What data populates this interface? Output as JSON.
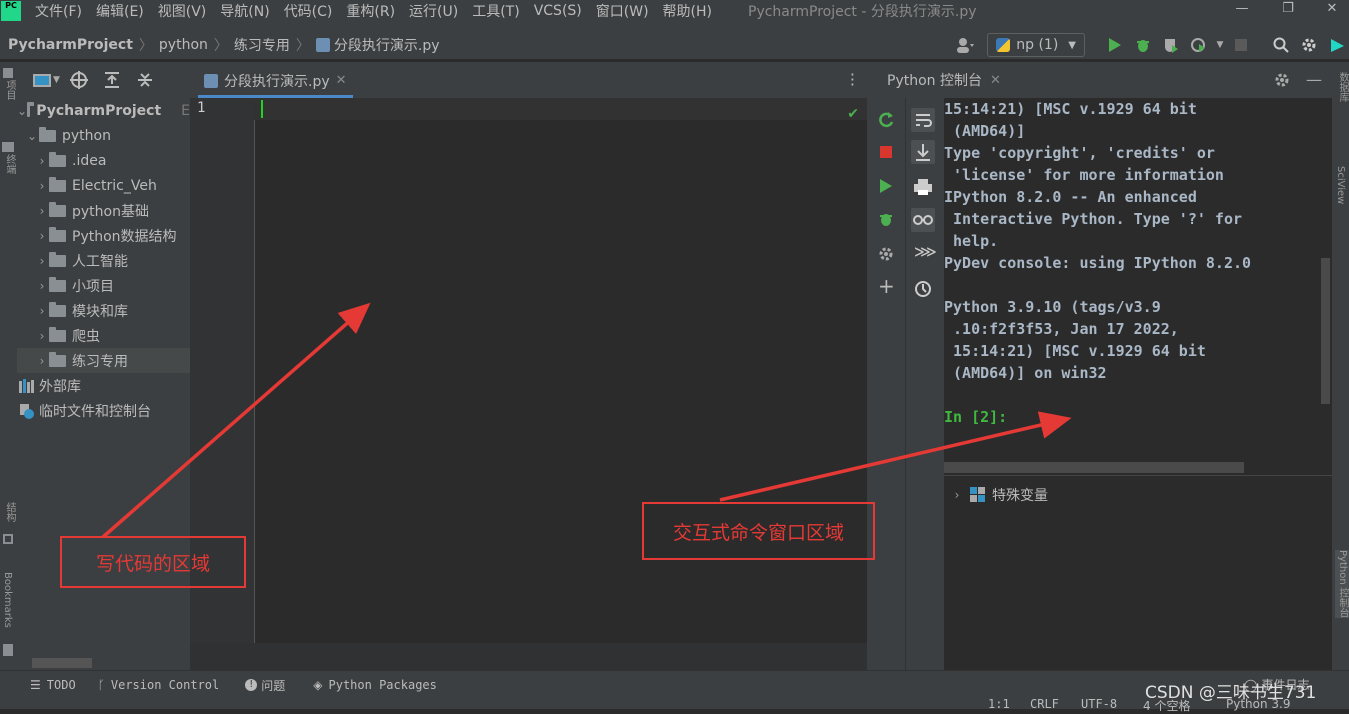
{
  "app": {
    "logo_text": "PC",
    "menu": [
      "文件(F)",
      "编辑(E)",
      "视图(V)",
      "导航(N)",
      "代码(C)",
      "重构(R)",
      "运行(U)",
      "工具(T)",
      "VCS(S)",
      "窗口(W)",
      "帮助(H)"
    ],
    "window_title": "PycharmProject - 分段执行演示.py"
  },
  "breadcrumb": [
    "PycharmProject",
    "python",
    "练习专用",
    "分段执行演示.py"
  ],
  "run_config": "np (1)",
  "left_stripe": {
    "project": "项目",
    "terminal": "终端",
    "structure": "结构",
    "bookmarks": "Bookmarks"
  },
  "right_stripe": {
    "db": "数据库",
    "sciview": "SciView",
    "python_console": "Python 控制台"
  },
  "project_tree": {
    "root": {
      "label": "PycharmProject",
      "suffix": "E"
    },
    "python": "python",
    "children": [
      ".idea",
      "Electric_Veh",
      "python基础",
      "Python数据结构",
      "人工智能",
      "小项目",
      "模块和库",
      "爬虫",
      "练习专用"
    ],
    "external": "外部库",
    "scratches": "临时文件和控制台"
  },
  "editor": {
    "tab_label": "分段执行演示.py",
    "line_number": "1"
  },
  "console": {
    "tab_label": "Python 控制台",
    "lines": [
      "15:14:21) [MSC v.1929 64 bit",
      " (AMD64)]",
      "Type 'copyright', 'credits' or",
      " 'license' for more information",
      "IPython 8.2.0 -- An enhanced",
      " Interactive Python. Type '?' for",
      " help.",
      "PyDev console: using IPython 8.2.0",
      "",
      "Python 3.9.10 (tags/v3.9",
      " .10:f2f3f53, Jan 17 2022,",
      " 15:14:21) [MSC v.1929 64 bit",
      " (AMD64)] on win32",
      ""
    ],
    "prompt": "In [2]:",
    "variables_label": "特殊变量"
  },
  "bottom_tools": [
    "TODO",
    "Version Control",
    "问题",
    "Python Packages"
  ],
  "event_log": "事件日志",
  "status": {
    "position": "1:1",
    "line_sep": "CRLF",
    "encoding": "UTF-8",
    "indent": "4 个空格",
    "interpreter": "Python 3.9"
  },
  "watermark": "CSDN @三味书生731",
  "annotations": {
    "code_area": "写代码的区域",
    "console_area": "交互式命令窗口区域"
  },
  "colors": {
    "annotation": "#e53935",
    "run": "#4caf50",
    "prompt": "#3fba3f"
  }
}
